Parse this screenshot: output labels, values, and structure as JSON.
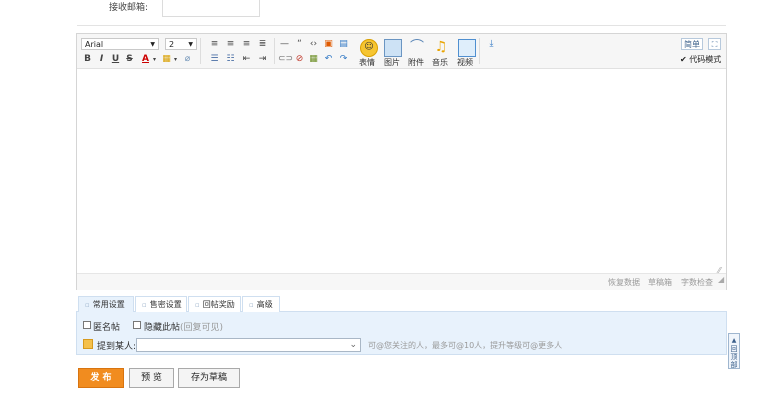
{
  "top": {
    "email_label": "接收邮箱:"
  },
  "toolbar": {
    "font_family": "Arial",
    "font_size": "2",
    "smiley_label": "表情",
    "image_label": "图片",
    "attach_label": "附件",
    "music_label": "音乐",
    "video_label": "视频",
    "simple_label": "简单",
    "code_mode_label": "代码模式"
  },
  "statusbar": {
    "restore": "恢复数据",
    "draft_box": "草稿箱",
    "word_check": "字数检查"
  },
  "tabs": [
    {
      "label": "常用设置"
    },
    {
      "label": "售密设置"
    },
    {
      "label": "回帖奖励"
    },
    {
      "label": "高级"
    }
  ],
  "panel": {
    "anonymous": "匿名帖",
    "hide_post": "隐藏此帖",
    "hide_note": "(回复可见)",
    "mention_label": "提到某人:",
    "mention_hint": "可@您关注的人，最多可@10人，提升等级可@更多人"
  },
  "side": {
    "label": "回顶部"
  },
  "actions": {
    "publish": "发 布",
    "preview": "预 览",
    "draft": "存为草稿"
  }
}
